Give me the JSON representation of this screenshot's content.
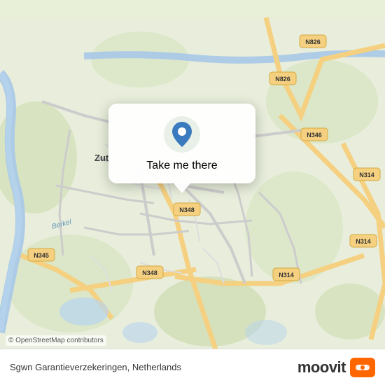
{
  "map": {
    "center_lat": 52.15,
    "center_lng": 6.2,
    "location_name": "Sgwn Garantieverzekeringen, Netherlands"
  },
  "tooltip": {
    "label": "Take me there"
  },
  "attribution": {
    "text": "© OpenStreetMap contributors"
  },
  "bottom_bar": {
    "location_text": "Sgwn Garantieverzekeringen, Netherlands"
  },
  "moovit": {
    "brand": "moovit"
  },
  "icons": {
    "pin": "map-pin-icon",
    "moovit_logo": "moovit-logo-icon"
  }
}
